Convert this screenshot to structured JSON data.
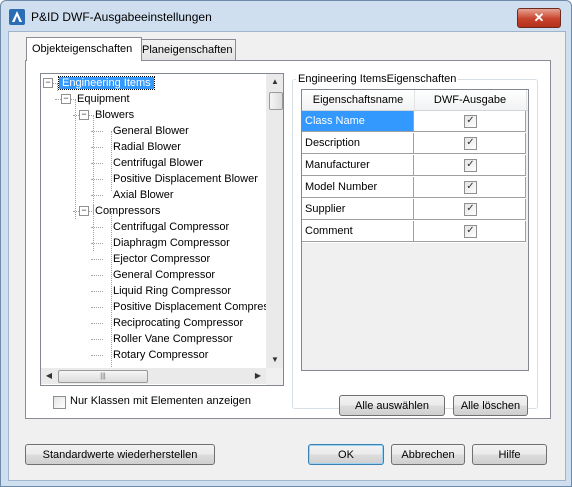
{
  "window": {
    "title": "P&ID DWF-Ausgabeeinstellungen",
    "close_glyph": "✕",
    "app_icon": "autocad-a-icon"
  },
  "tabs": [
    {
      "label": "Objekteigenschaften",
      "active": true
    },
    {
      "label": "Planeigenschaften",
      "active": false
    }
  ],
  "tree": {
    "nodes": [
      {
        "label": "Engineering Items",
        "depth": 0,
        "expanded": true,
        "selected": true
      },
      {
        "label": "Equipment",
        "depth": 1,
        "expanded": true
      },
      {
        "label": "Blowers",
        "depth": 2,
        "expanded": true
      },
      {
        "label": "General Blower",
        "depth": 3
      },
      {
        "label": "Radial Blower",
        "depth": 3
      },
      {
        "label": "Centrifugal Blower",
        "depth": 3
      },
      {
        "label": "Positive Displacement Blower",
        "depth": 3
      },
      {
        "label": "Axial Blower",
        "depth": 3
      },
      {
        "label": "Compressors",
        "depth": 2,
        "expanded": true
      },
      {
        "label": "Centrifugal Compressor",
        "depth": 3
      },
      {
        "label": "Diaphragm Compressor",
        "depth": 3
      },
      {
        "label": "Ejector Compressor",
        "depth": 3
      },
      {
        "label": "General Compressor",
        "depth": 3
      },
      {
        "label": "Liquid Ring Compressor",
        "depth": 3
      },
      {
        "label": "Positive Displacement Compres",
        "depth": 3
      },
      {
        "label": "Reciprocating Compressor",
        "depth": 3
      },
      {
        "label": "Roller Vane Compressor",
        "depth": 3
      },
      {
        "label": "Rotary Compressor",
        "depth": 3
      }
    ]
  },
  "filter_checkbox": {
    "label": "Nur Klassen mit Elementen anzeigen",
    "checked": false
  },
  "properties": {
    "group_title": "Engineering ItemsEigenschaften",
    "columns": [
      "Eigenschaftsname",
      "DWF-Ausgabe"
    ],
    "rows": [
      {
        "name": "Class Name",
        "checked": true,
        "selected": true
      },
      {
        "name": "Description",
        "checked": true
      },
      {
        "name": "Manufacturer",
        "checked": true
      },
      {
        "name": "Model Number",
        "checked": true
      },
      {
        "name": "Supplier",
        "checked": true
      },
      {
        "name": "Comment",
        "checked": true
      }
    ],
    "check_glyph": "✓",
    "select_all_label": "Alle auswählen",
    "clear_all_label": "Alle löschen"
  },
  "footer": {
    "restore_defaults_label": "Standardwerte wiederherstellen",
    "ok_label": "OK",
    "cancel_label": "Abbrechen",
    "help_label": "Hilfe"
  },
  "colors": {
    "selection": "#3399ff",
    "window_frame": "#cfdff0",
    "close_button": "#c7432c"
  }
}
